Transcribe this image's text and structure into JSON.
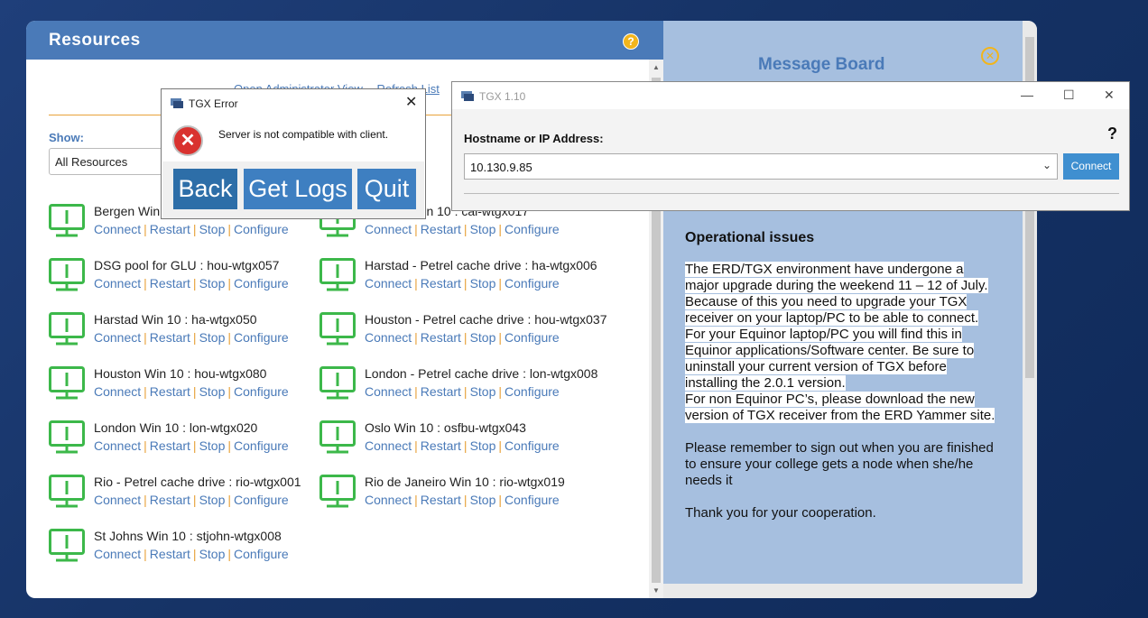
{
  "resources": {
    "title": "Resources",
    "help_icon": "question-circle-icon",
    "admin_link": "Open Administrator View",
    "refresh_link": "Refresh List",
    "show_label": "Show:",
    "show_value": "All Resources",
    "actions": [
      "Connect",
      "Restart",
      "Stop",
      "Configure"
    ],
    "items": [
      {
        "name": "Bergen Win 10 : ber-wtgx015"
      },
      {
        "name": "Calgary Win 10 : cal-wtgx017"
      },
      {
        "name": "DSG pool for GLU : hou-wtgx057"
      },
      {
        "name": "Harstad - Petrel cache drive : ha-wtgx006"
      },
      {
        "name": "Harstad Win 10 : ha-wtgx050"
      },
      {
        "name": "Houston - Petrel cache drive : hou-wtgx037"
      },
      {
        "name": "Houston Win 10 : hou-wtgx080"
      },
      {
        "name": "London - Petrel cache drive : lon-wtgx008"
      },
      {
        "name": "London Win 10 : lon-wtgx020"
      },
      {
        "name": "Oslo Win 10 : osfbu-wtgx043"
      },
      {
        "name": "Rio - Petrel cache drive : rio-wtgx001"
      },
      {
        "name": "Rio de Janeiro Win 10 : rio-wtgx019"
      },
      {
        "name": "St Johns Win 10 : stjohn-wtgx008"
      }
    ]
  },
  "message_board": {
    "title": "Message Board",
    "heading": "Operational issues",
    "paragraph1": "The ERD/TGX environment have undergone a major upgrade during the weekend 11 – 12 of July. Because of this you need to upgrade your TGX receiver on your laptop/PC to be able to connect. For your Equinor laptop/PC you will find this in Equinor applications/Software center. Be sure to uninstall your current version of TGX before installing the 2.0.1 version.",
    "paragraph2": "For non Equinor PC’s, please download the new version of TGX receiver from the ERD Yammer site.",
    "paragraph3": "Please remember to sign out when you are finished to ensure your college gets a node when she/he needs it",
    "paragraph4": "Thank you for your cooperation."
  },
  "tgx_window": {
    "title": "TGX 1.10",
    "host_label": "Hostname or IP Address:",
    "host_value": "10.130.9.85",
    "help": "?",
    "connect": "Connect"
  },
  "error_dialog": {
    "title": "TGX Error",
    "message": "Server is not compatible with client.",
    "back": "Back",
    "get_logs": "Get Logs",
    "quit": "Quit"
  },
  "colors": {
    "header_blue": "#4a7ab8",
    "accent_orange": "#e8a23a",
    "monitor_green": "#3cb84a",
    "message_bg": "#a6bfdf"
  }
}
